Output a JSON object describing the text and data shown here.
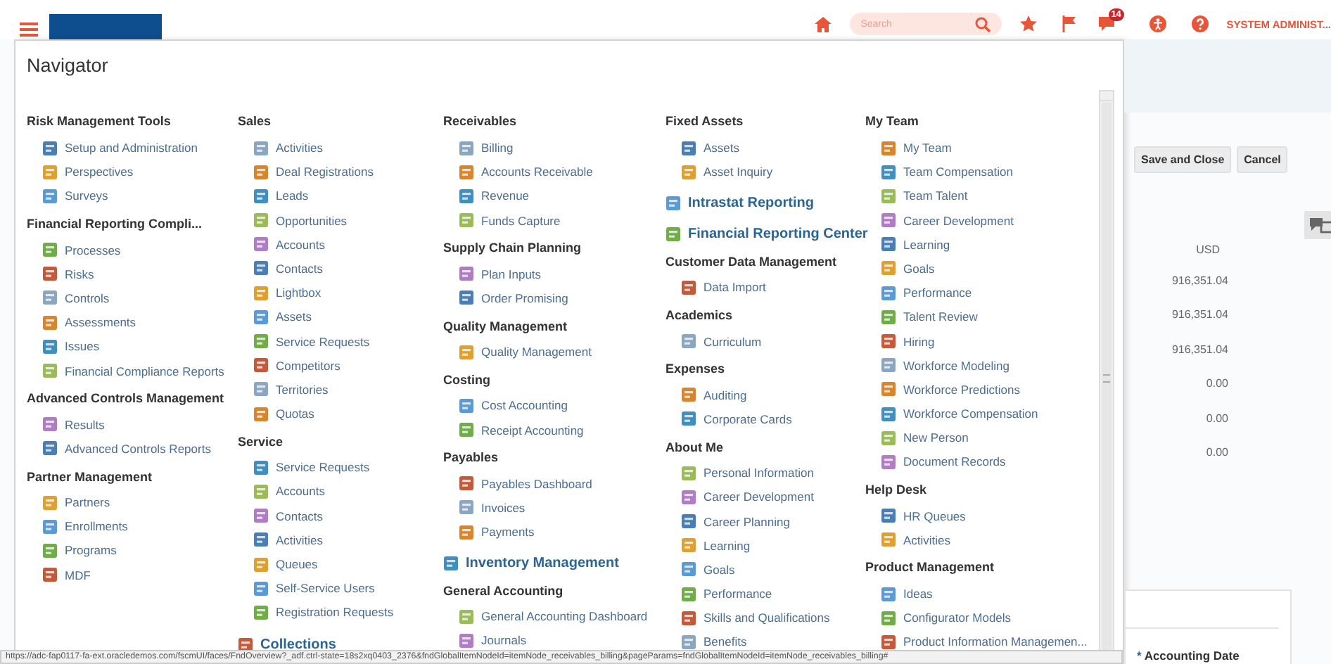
{
  "top_bar": {
    "search": {
      "placeholder": "Search"
    },
    "notification_count": "14",
    "user": "SYSTEM ADMINIST..."
  },
  "navigator": {
    "title": "Navigator",
    "columns": [
      [
        {
          "kind": "group",
          "title": "Risk Management Tools",
          "items": [
            "Setup and Administration",
            "Perspectives",
            "Surveys"
          ]
        },
        {
          "kind": "group",
          "title": "Financial Reporting Compli...",
          "items": [
            "Processes",
            "Risks",
            "Controls",
            "Assessments",
            "Issues",
            "Financial Compliance Reports"
          ]
        },
        {
          "kind": "group",
          "title": "Advanced Controls Management",
          "items": [
            "Results",
            "Advanced Controls Reports"
          ]
        },
        {
          "kind": "group",
          "title": "Partner Management",
          "items": [
            "Partners",
            "Enrollments",
            "Programs",
            "MDF"
          ]
        }
      ],
      [
        {
          "kind": "group",
          "title": "Sales",
          "items": [
            "Activities",
            "Deal Registrations",
            "Leads",
            "Opportunities",
            "Accounts",
            "Contacts",
            "Lightbox",
            "Assets",
            "Service Requests",
            "Competitors",
            "Territories",
            "Quotas"
          ]
        },
        {
          "kind": "group",
          "title": "Service",
          "items": [
            "Service Requests",
            "Accounts",
            "Contacts",
            "Activities",
            "Queues",
            "Self-Service Users",
            "Registration Requests"
          ]
        },
        {
          "kind": "link",
          "label": "Collections"
        }
      ],
      [
        {
          "kind": "group",
          "title": "Receivables",
          "items": [
            "Billing",
            "Accounts Receivable",
            "Revenue",
            "Funds Capture"
          ]
        },
        {
          "kind": "group",
          "title": "Supply Chain Planning",
          "items": [
            "Plan Inputs",
            "Order Promising"
          ]
        },
        {
          "kind": "group",
          "title": "Quality Management",
          "items": [
            "Quality Management"
          ]
        },
        {
          "kind": "group",
          "title": "Costing",
          "items": [
            "Cost Accounting",
            "Receipt Accounting"
          ]
        },
        {
          "kind": "group",
          "title": "Payables",
          "items": [
            "Payables Dashboard",
            "Invoices",
            "Payments"
          ]
        },
        {
          "kind": "link",
          "label": "Inventory Management"
        },
        {
          "kind": "group",
          "title": "General Accounting",
          "items": [
            "General Accounting Dashboard",
            "Journals"
          ]
        }
      ],
      [
        {
          "kind": "group",
          "title": "Fixed Assets",
          "items": [
            "Assets",
            "Asset Inquiry"
          ]
        },
        {
          "kind": "link",
          "label": "Intrastat Reporting"
        },
        {
          "kind": "link",
          "label": "Financial Reporting Center"
        },
        {
          "kind": "group",
          "title": "Customer Data Management",
          "items": [
            "Data Import"
          ]
        },
        {
          "kind": "group",
          "title": "Academics",
          "items": [
            "Curriculum"
          ]
        },
        {
          "kind": "group",
          "title": "Expenses",
          "items": [
            "Auditing",
            "Corporate Cards"
          ]
        },
        {
          "kind": "group",
          "title": "About Me",
          "items": [
            "Personal Information",
            "Career Development",
            "Career Planning",
            "Learning",
            "Goals",
            "Performance",
            "Skills and Qualifications",
            "Benefits"
          ]
        }
      ],
      [
        {
          "kind": "group",
          "title": "My Team",
          "items": [
            "My Team",
            "Team Compensation",
            "Team Talent",
            "Career Development",
            "Learning",
            "Goals",
            "Performance",
            "Talent Review",
            "Hiring",
            "Workforce Modeling",
            "Workforce Predictions",
            "Workforce Compensation",
            "New Person",
            "Document Records"
          ]
        },
        {
          "kind": "group",
          "title": "Help Desk",
          "items": [
            "HR Queues",
            "Activities"
          ]
        },
        {
          "kind": "group",
          "title": "Product Management",
          "items": [
            "Ideas",
            "Configurator Models",
            "Product Information Managemen..."
          ]
        }
      ]
    ]
  },
  "page": {
    "buttons": [
      "Save and Close",
      "Cancel"
    ],
    "amounts": [
      "USD",
      "916,351.04",
      "916,351.04",
      "916,351.04",
      "0.00",
      "0.00",
      "0.00"
    ],
    "field": {
      "label": "Accounting Date",
      "marker": "*"
    }
  },
  "status_url": "https://adc-fap0117-fa-ext.oracledemos.com/fscmUI/faces/FndOverview?_adf.ctrl-state=18s2xq0403_2376&fndGlobalItemNodeId=itemNode_receivables_billing&pageParams=fndGlobalItemNodeId=itemNode_receivables_billing#"
}
